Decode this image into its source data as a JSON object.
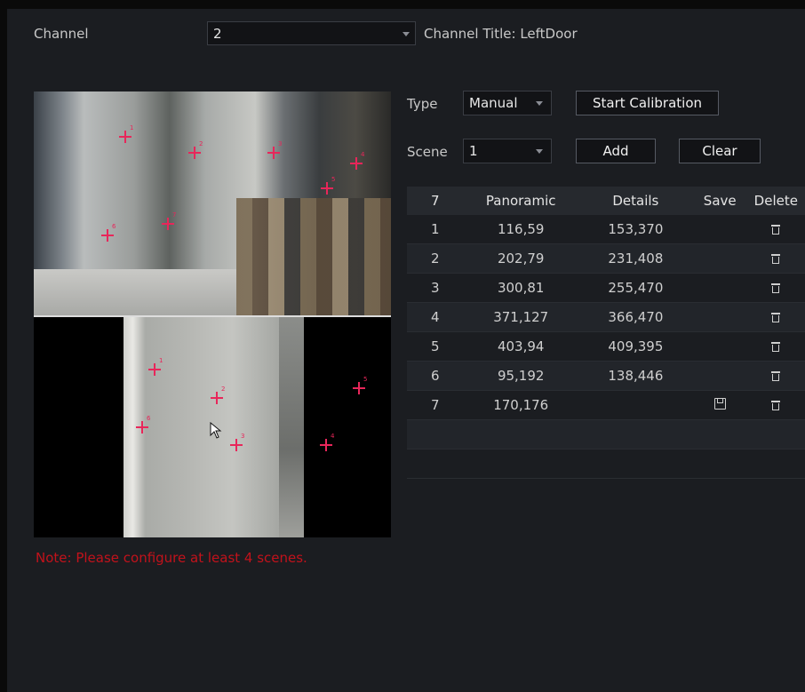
{
  "header": {
    "channel_label": "Channel",
    "channel_value": "2",
    "channel_title": "Channel Title: LeftDoor"
  },
  "controls": {
    "type_label": "Type",
    "type_value": "Manual",
    "start_calibration": "Start Calibration",
    "scene_label": "Scene",
    "scene_value": "1",
    "add": "Add",
    "clear": "Clear"
  },
  "table": {
    "headers": [
      "7",
      "Panoramic",
      "Details",
      "Save",
      "Delete"
    ],
    "rows": [
      {
        "id": "1",
        "panoramic": "116,59",
        "details": "153,370",
        "saveable": false
      },
      {
        "id": "2",
        "panoramic": "202,79",
        "details": "231,408",
        "saveable": false
      },
      {
        "id": "3",
        "panoramic": "300,81",
        "details": "255,470",
        "saveable": false
      },
      {
        "id": "4",
        "panoramic": "371,127",
        "details": "366,470",
        "saveable": false
      },
      {
        "id": "5",
        "panoramic": "403,94",
        "details": "409,395",
        "saveable": false
      },
      {
        "id": "6",
        "panoramic": "95,192",
        "details": "138,446",
        "saveable": false
      },
      {
        "id": "7",
        "panoramic": "170,176",
        "details": "",
        "saveable": true
      }
    ]
  },
  "markers": {
    "panoramic": [
      "1",
      "2",
      "3",
      "4",
      "5",
      "6",
      "7"
    ],
    "details": [
      "1",
      "2",
      "3",
      "4",
      "5",
      "6"
    ]
  },
  "note": "Note: Please configure at least 4 scenes.",
  "colors": {
    "marker": "#e8265a",
    "note": "#c2121b"
  }
}
